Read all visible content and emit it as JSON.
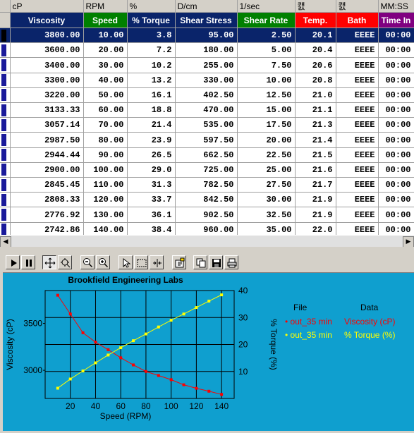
{
  "grid": {
    "units": [
      "cP",
      "RPM",
      "%",
      "D/cm",
      "1/sec",
      "캜",
      "캜",
      "MM:SS"
    ],
    "columns": [
      {
        "label": "Viscosity",
        "color": "#0a246a"
      },
      {
        "label": "Speed",
        "color": "#008000"
      },
      {
        "label": "% Torque",
        "color": "#0a246a"
      },
      {
        "label": "Shear Stress",
        "color": "#0a246a"
      },
      {
        "label": "Shear Rate",
        "color": "#008000"
      },
      {
        "label": "Temp.",
        "color": "#ff0000"
      },
      {
        "label": "Bath",
        "color": "#ff0000"
      },
      {
        "label": "Time In",
        "color": "#800080"
      }
    ],
    "rows": [
      [
        "3800.00",
        "10.00",
        "3.8",
        "95.00",
        "2.50",
        "20.1",
        "EEEE",
        "00:00"
      ],
      [
        "3600.00",
        "20.00",
        "7.2",
        "180.00",
        "5.00",
        "20.4",
        "EEEE",
        "00:00"
      ],
      [
        "3400.00",
        "30.00",
        "10.2",
        "255.00",
        "7.50",
        "20.6",
        "EEEE",
        "00:00"
      ],
      [
        "3300.00",
        "40.00",
        "13.2",
        "330.00",
        "10.00",
        "20.8",
        "EEEE",
        "00:00"
      ],
      [
        "3220.00",
        "50.00",
        "16.1",
        "402.50",
        "12.50",
        "21.0",
        "EEEE",
        "00:00"
      ],
      [
        "3133.33",
        "60.00",
        "18.8",
        "470.00",
        "15.00",
        "21.1",
        "EEEE",
        "00:00"
      ],
      [
        "3057.14",
        "70.00",
        "21.4",
        "535.00",
        "17.50",
        "21.3",
        "EEEE",
        "00:00"
      ],
      [
        "2987.50",
        "80.00",
        "23.9",
        "597.50",
        "20.00",
        "21.4",
        "EEEE",
        "00:00"
      ],
      [
        "2944.44",
        "90.00",
        "26.5",
        "662.50",
        "22.50",
        "21.5",
        "EEEE",
        "00:00"
      ],
      [
        "2900.00",
        "100.00",
        "29.0",
        "725.00",
        "25.00",
        "21.6",
        "EEEE",
        "00:00"
      ],
      [
        "2845.45",
        "110.00",
        "31.3",
        "782.50",
        "27.50",
        "21.7",
        "EEEE",
        "00:00"
      ],
      [
        "2808.33",
        "120.00",
        "33.7",
        "842.50",
        "30.00",
        "21.9",
        "EEEE",
        "00:00"
      ],
      [
        "2776.92",
        "130.00",
        "36.1",
        "902.50",
        "32.50",
        "21.9",
        "EEEE",
        "00:00"
      ],
      [
        "2742.86",
        "140.00",
        "38.4",
        "960.00",
        "35.00",
        "22.0",
        "EEEE",
        "00:00"
      ]
    ],
    "selected_row": 0
  },
  "toolbar": {
    "icons": [
      "play-icon",
      "pause-icon",
      "pan-icon",
      "zoom-area-icon",
      "zoom-out-icon",
      "zoom-in-icon",
      "pointer-icon",
      "select-rect-icon",
      "split-icon",
      "properties-icon",
      "copy-icon",
      "save-icon",
      "print-icon"
    ]
  },
  "chart": {
    "title": "Brookfield Engineering Labs",
    "legend": {
      "file_header": "File",
      "data_header": "Data",
      "entries": [
        {
          "file": "out_35 min",
          "data": "Viscosity (cP)",
          "color": "#ff0000"
        },
        {
          "file": "out_35 min",
          "data": "% Torque (%)",
          "color": "#ffff00"
        }
      ]
    }
  },
  "chart_data": {
    "type": "line",
    "title": "Brookfield Engineering Labs",
    "xlabel": "Speed (RPM)",
    "ylabel": "Viscosity (cP)",
    "y2label": "% Torque (%)",
    "xlim": [
      0,
      150
    ],
    "ylim": [
      2700,
      3850
    ],
    "y2lim": [
      0,
      40
    ],
    "x_ticks": [
      "20",
      "40",
      "60",
      "80",
      "100",
      "120",
      "140"
    ],
    "y_ticks": [
      "3000",
      "3500"
    ],
    "y2_ticks": [
      "10",
      "20",
      "30",
      "40"
    ],
    "grid": true,
    "background": "#0f9fcf",
    "plot_background": "#0f9fcf",
    "x": [
      10,
      20,
      30,
      40,
      50,
      60,
      70,
      80,
      90,
      100,
      110,
      120,
      130,
      140
    ],
    "series": [
      {
        "name": "Viscosity (cP)",
        "axis": "left",
        "color": "#ff0000",
        "values": [
          3800.0,
          3600.0,
          3400.0,
          3300.0,
          3220.0,
          3133.33,
          3057.14,
          2987.5,
          2944.44,
          2900.0,
          2845.45,
          2808.33,
          2776.92,
          2742.86
        ]
      },
      {
        "name": "% Torque (%)",
        "axis": "right",
        "color": "#ffff00",
        "values": [
          3.8,
          7.2,
          10.2,
          13.2,
          16.1,
          18.8,
          21.4,
          23.9,
          26.5,
          29.0,
          31.3,
          33.7,
          36.1,
          38.4
        ]
      }
    ]
  }
}
